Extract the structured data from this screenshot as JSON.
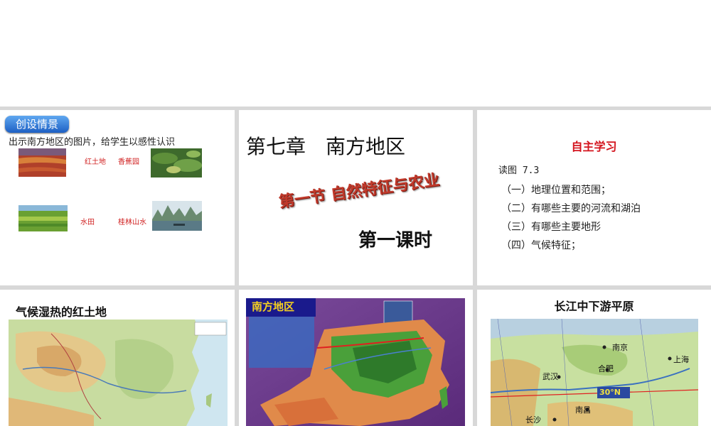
{
  "slide1": {
    "badge": "创设情景",
    "intro": "出示南方地区的图片，给学生以感性认识",
    "captions": [
      "红土地",
      "香蕉园",
      "水田",
      "桂林山水"
    ]
  },
  "slide2": {
    "chapter": "第七章　南方地区",
    "section": "第一节 自然特征与农业",
    "lesson": "第一课时"
  },
  "slide3": {
    "title": "自主学习",
    "read": "读图 7.3",
    "questions": [
      "（一）地理位置和范围；",
      "（二）有哪些主要的河流和湖泊",
      "（三）有哪些主要地形",
      "（四）气候特征；"
    ]
  },
  "slide4": {
    "title": "气候湿热的红土地"
  },
  "slide5": {
    "map_title": "南方地区"
  },
  "slide6": {
    "title": "长江中下游平原",
    "map_labels": {
      "nanjing": "南京",
      "shanghai": "上海",
      "hefei": "合肥",
      "wuhan": "武汉",
      "nanchang": "南昌",
      "changsha": "长沙",
      "latitude": "30°N"
    }
  },
  "colors": {
    "badge": "#1d5fc4",
    "caption": "#d02020",
    "self_title": "#d4141e",
    "section": "#c0392b",
    "map_title_bg": "#1a1a8c",
    "map_title_text": "#f5d020"
  }
}
